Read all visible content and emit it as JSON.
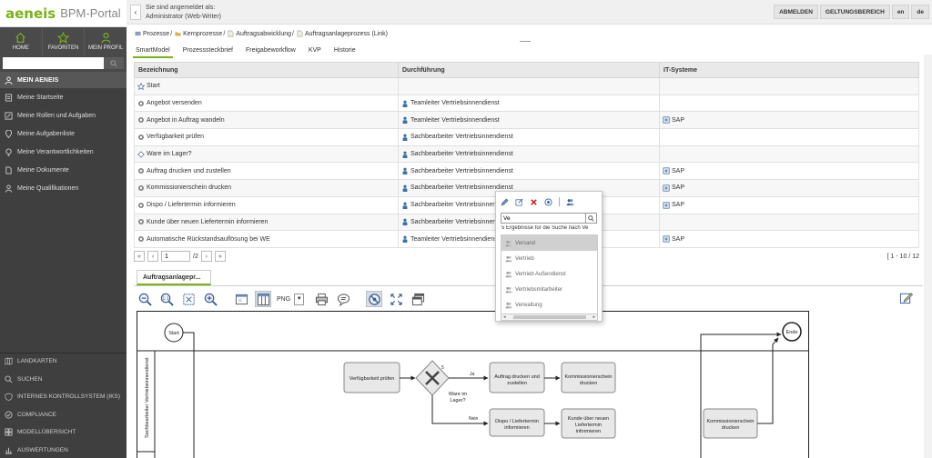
{
  "app": {
    "brand": "aeneis",
    "product": "BPM-Portal"
  },
  "topnav": [
    {
      "label": "HOME",
      "icon": "home-icon"
    },
    {
      "label": "FAVORITEN",
      "icon": "star-icon"
    },
    {
      "label": "MEIN PROFIL",
      "icon": "person-icon"
    }
  ],
  "sidebar": {
    "search_placeholder": "",
    "section": "MEIN AENEIS",
    "items": [
      {
        "label": "Meine Startseite",
        "icon": "page-icon"
      },
      {
        "label": "Meine Rollen und Aufgaben",
        "icon": "pencil-icon"
      },
      {
        "label": "Meine Aufgabenliste",
        "icon": "location-icon"
      },
      {
        "label": "Meine Verantwortlichkeiten",
        "icon": "lightbulb-icon"
      },
      {
        "label": "Meine Dokumente",
        "icon": "document-icon"
      },
      {
        "label": "Meine Qualifikationen",
        "icon": "people-icon"
      }
    ],
    "bottom_items": [
      {
        "label": "LANDKARTEN",
        "icon": "map-icon"
      },
      {
        "label": "SUCHEN",
        "icon": "search-icon"
      },
      {
        "label": "INTERNES KONTROLLSYSTEM (IKS)",
        "icon": "shield-icon"
      },
      {
        "label": "COMPLIANCE",
        "icon": "check-circle-icon"
      },
      {
        "label": "MODELLÜBERSICHT",
        "icon": "grid-icon"
      },
      {
        "label": "AUSWERTUNGEN",
        "icon": "chart-icon"
      }
    ]
  },
  "topbar": {
    "login_line1": "Sie sind angemeldet als:",
    "login_line2": "Administrator  (Web-Writer)",
    "buttons": [
      "ABMELDEN",
      "GELTUNGSBEREICH",
      "en",
      "de"
    ]
  },
  "breadcrumb": [
    "Prozesse",
    "Kernprozesse",
    "Auftragsabwicklung",
    "Auftragsanlageprozess (Link)"
  ],
  "view_tabs": [
    "SmartModel",
    "Prozesssteckbrief",
    "Freigabeworkflow",
    "KVP",
    "Historie"
  ],
  "table": {
    "headers": [
      "Bezeichnung",
      "Durchführung",
      "IT-Systeme"
    ],
    "rows": [
      {
        "name": "Start",
        "type": "star",
        "role": "",
        "it": ""
      },
      {
        "name": "Angebot versenden",
        "type": "gear",
        "role": "Teamleiter Vertriebsinnendienst",
        "it": ""
      },
      {
        "name": "Angebot in Auftrag wandeln",
        "type": "gear",
        "role": "Teamleiter Vertriebsinnendienst",
        "it": "SAP"
      },
      {
        "name": "Verfügbarkeit prüfen",
        "type": "gear",
        "role": "Sachbearbeiter Vertriebsinnendienst",
        "it": ""
      },
      {
        "name": "Ware im Lager?",
        "type": "diamond",
        "role": "Sachbearbeiter Vertriebsinnendienst",
        "it": ""
      },
      {
        "name": "Auftrag drucken und zustellen",
        "type": "gear",
        "role": "Sachbearbeiter Vertriebsinnendienst",
        "it": "SAP"
      },
      {
        "name": "Kommissionierschein drucken",
        "type": "gear",
        "role": "Sachbearbeiter Vertriebsinnendienst",
        "it": "SAP"
      },
      {
        "name": "Dispo / Liefertermin informieren",
        "type": "gear",
        "role": "Sachbearbeiter Vertriebsinnend",
        "it": "SAP"
      },
      {
        "name": "Kunde über neuen Liefertermin informieren",
        "type": "gear",
        "role": "Sachbearbeiter Vertriebsinnend",
        "it": ""
      },
      {
        "name": "Automatische Rückstandsauflösung bei WE",
        "type": "gear",
        "role": "Teamleiter Vertriebsinnendienst",
        "it": "SAP"
      }
    ]
  },
  "pager": {
    "page": "1",
    "total": "/2",
    "range": "[ 1 - 10 / 12"
  },
  "diagram": {
    "tab": "Auftragsanlagepr...",
    "export_format": "PNG",
    "lane": "Sachbearbeiter Vertriebsinnendienst",
    "start": "Start",
    "end": "Ende",
    "activities": {
      "verfuegbarkeit": "Verfügbarkeit prüfen",
      "auftrag1": "Auftrag drucken und",
      "auftrag2": "zustellen",
      "kommi1": "Kommissionierschein",
      "kommi2": "drucken",
      "dispo1": "Dispo / Liefertermin",
      "dispo2": "informieren",
      "kunde1": "Kunde über neuen",
      "kunde2": "Liefertermin",
      "kunde3": "informieren",
      "kommi3a": "Kommissionierschein",
      "kommi3b": "drucken"
    },
    "gateway_label1": "Ware im",
    "gateway_label2": "Lager?",
    "gateway_count": "5",
    "yes": "Ja",
    "no": "Nein"
  },
  "popup": {
    "search_value": "Ve",
    "result_count": "5 Ergebnisse für die Suche nach Ve",
    "results": [
      "Versand",
      "Vertrieb",
      "Vertrieb Außendienst",
      "Vertriebsmitarbeiter",
      "Verwaltung"
    ]
  },
  "colors": {
    "brand_green": "#7ab317",
    "sidebar_bg": "#3f3f3f",
    "activity_fill": "#e8e8e8"
  }
}
